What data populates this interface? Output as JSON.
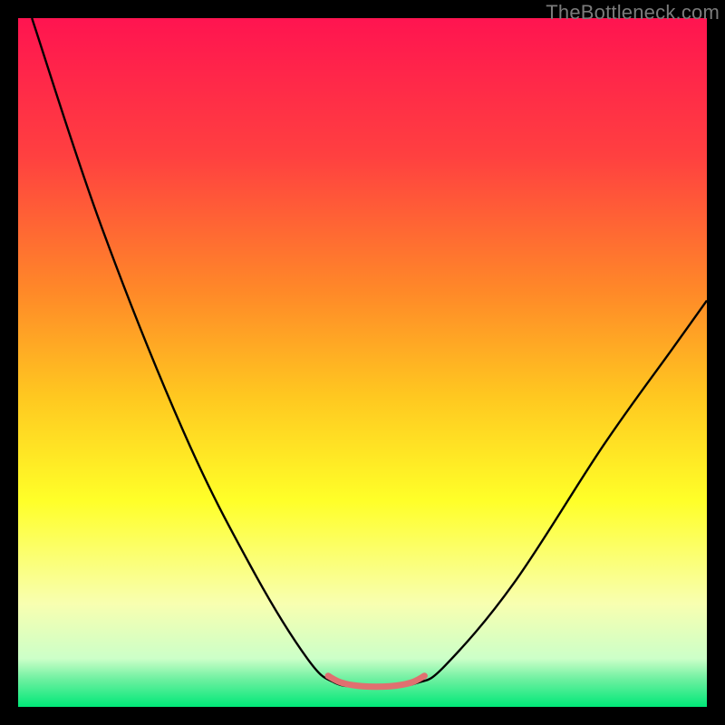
{
  "watermark": "TheBottleneck.com",
  "chart_data": {
    "type": "line",
    "title": "",
    "xlabel": "",
    "ylabel": "",
    "xlim": [
      0,
      100
    ],
    "ylim": [
      0,
      100
    ],
    "background_gradient": {
      "stops": [
        {
          "y": 0,
          "color": "#ff1450"
        },
        {
          "y": 20,
          "color": "#ff4040"
        },
        {
          "y": 40,
          "color": "#ff8a28"
        },
        {
          "y": 55,
          "color": "#ffc820"
        },
        {
          "y": 70,
          "color": "#ffff28"
        },
        {
          "y": 85,
          "color": "#f8ffb0"
        },
        {
          "y": 93,
          "color": "#ccffc8"
        },
        {
          "y": 96,
          "color": "#6df0a0"
        },
        {
          "y": 100,
          "color": "#00e878"
        }
      ]
    },
    "series": [
      {
        "name": "bottleneck-curve",
        "color": "#000000",
        "width": 2.4,
        "points": [
          {
            "x": 2,
            "y": 0
          },
          {
            "x": 12,
            "y": 30
          },
          {
            "x": 24,
            "y": 60
          },
          {
            "x": 34,
            "y": 80
          },
          {
            "x": 42,
            "y": 93
          },
          {
            "x": 46,
            "y": 96.5
          },
          {
            "x": 50,
            "y": 97
          },
          {
            "x": 54,
            "y": 97
          },
          {
            "x": 58,
            "y": 96.5
          },
          {
            "x": 62,
            "y": 94
          },
          {
            "x": 72,
            "y": 82
          },
          {
            "x": 85,
            "y": 62
          },
          {
            "x": 95,
            "y": 48
          },
          {
            "x": 100,
            "y": 41
          }
        ]
      },
      {
        "name": "bottom-highlight",
        "color": "#e07070",
        "width": 7,
        "points": [
          {
            "x": 45,
            "y": 95.5
          },
          {
            "x": 47,
            "y": 96.5
          },
          {
            "x": 50,
            "y": 97
          },
          {
            "x": 54,
            "y": 97
          },
          {
            "x": 57,
            "y": 96.5
          },
          {
            "x": 59,
            "y": 95.5
          }
        ]
      }
    ]
  }
}
